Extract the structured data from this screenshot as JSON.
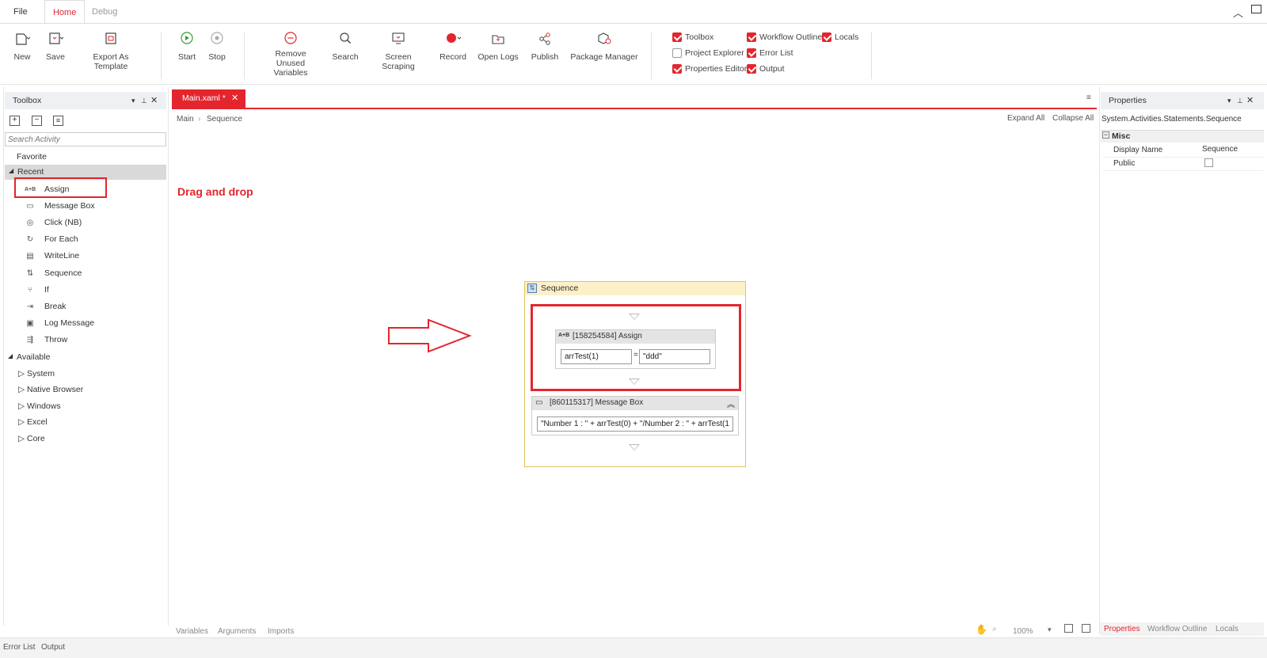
{
  "menu": {
    "file": "File",
    "home": "Home",
    "debug": "Debug"
  },
  "ribbon": {
    "new": "New",
    "save": "Save",
    "export": "Export As Template",
    "start": "Start",
    "stop": "Stop",
    "remove_unused_1": "Remove Unused",
    "remove_unused_2": "Variables",
    "search": "Search",
    "screen_scraping": "Screen Scraping",
    "record": "Record",
    "open_logs": "Open Logs",
    "publish": "Publish",
    "package_manager": "Package Manager"
  },
  "view_options": [
    {
      "label": "Toolbox",
      "checked": true
    },
    {
      "label": "Workflow Outline",
      "checked": true
    },
    {
      "label": "Locals",
      "checked": true
    },
    {
      "label": "Project Explorer",
      "checked": false
    },
    {
      "label": "Error List",
      "checked": true
    },
    {
      "label": "Properties Editor",
      "checked": true
    },
    {
      "label": "Output",
      "checked": true
    }
  ],
  "toolbox": {
    "title": "Toolbox",
    "search_placeholder": "Search Activity",
    "favorite": "Favorite",
    "recent": "Recent",
    "recent_items": [
      "Assign",
      "Message Box",
      "Click (NB)",
      "For Each",
      "WriteLine",
      "Sequence",
      "If",
      "Break",
      "Log Message",
      "Throw"
    ],
    "available": "Available",
    "available_items": [
      "System",
      "Native Browser",
      "Windows",
      "Excel",
      "Core"
    ]
  },
  "designer": {
    "doc_tab": "Main.xaml *",
    "breadcrumb_main": "Main",
    "breadcrumb_sequence": "Sequence",
    "expand_all": "Expand All",
    "collapse_all": "Collapse All",
    "annotation": "Drag and drop",
    "sequence_title": "Sequence",
    "assign_title": "[158254584] Assign",
    "assign_to": "arrTest(1)",
    "assign_eq": "=",
    "assign_value": "\"ddd\"",
    "msgbox_title": "[860115317] Message Box",
    "msgbox_text": "\"Number 1 : \" + arrTest(0) + \"/Number 2 : \" + arrTest(1",
    "bottom_tabs": [
      "Variables",
      "Arguments",
      "Imports"
    ],
    "zoom": "100%"
  },
  "properties": {
    "title": "Properties",
    "type": "System.Activities.Statements.Sequence",
    "section": "Misc",
    "display_name_label": "Display Name",
    "display_name_value": "Sequence",
    "public_label": "Public",
    "bottom_tabs": [
      "Properties",
      "Workflow Outline",
      "Locals"
    ]
  },
  "status": {
    "error_list": "Error List",
    "output": "Output"
  },
  "colors": {
    "accent": "#e3262e",
    "sequence_border": "#e8c15a",
    "sequence_header": "#fbf0c8"
  }
}
